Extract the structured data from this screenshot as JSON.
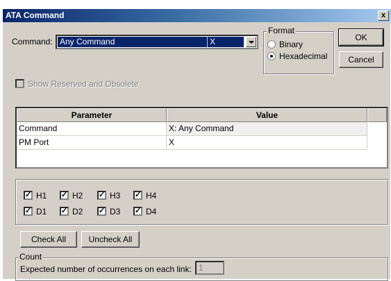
{
  "window": {
    "title": "ATA Command",
    "close_label": "x"
  },
  "command": {
    "label": "Command:",
    "value": "Any Command",
    "code": "X"
  },
  "format": {
    "legend": "Format",
    "options": [
      {
        "label": "Binary",
        "selected": false
      },
      {
        "label": "Hexadecimal",
        "selected": true
      }
    ]
  },
  "buttons": {
    "ok": "OK",
    "cancel": "Cancel",
    "check_all": "Check All",
    "uncheck_all": "Uncheck All"
  },
  "show_reserved": {
    "label": "Show Reserved and Obsolete",
    "checked": false,
    "enabled": false
  },
  "table": {
    "headers": [
      "Parameter",
      "Value"
    ],
    "rows": [
      {
        "parameter": "Command",
        "value": "X: Any Command"
      },
      {
        "parameter": "PM Port",
        "value": "X"
      }
    ]
  },
  "hosts": [
    {
      "label": "H1",
      "checked": true
    },
    {
      "label": "H2",
      "checked": true
    },
    {
      "label": "H3",
      "checked": true
    },
    {
      "label": "H4",
      "checked": true
    },
    {
      "label": "D1",
      "checked": true
    },
    {
      "label": "D2",
      "checked": true
    },
    {
      "label": "D3",
      "checked": true
    },
    {
      "label": "D4",
      "checked": true
    }
  ],
  "count": {
    "legend": "Count",
    "label": "Expected number of occurrences on each link:",
    "value": "1"
  },
  "check_mark": "✓"
}
